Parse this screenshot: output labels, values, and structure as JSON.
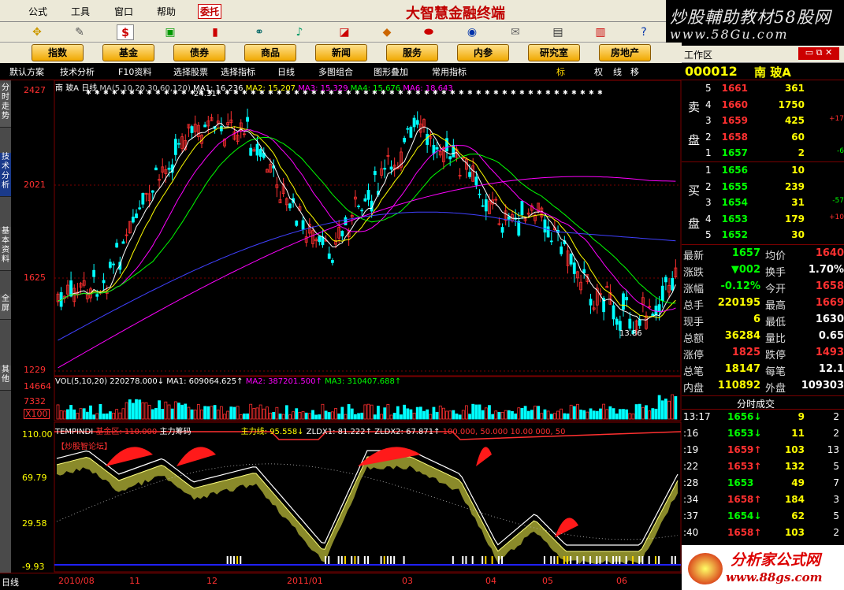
{
  "menu": {
    "items": [
      "公式",
      "工具",
      "窗口",
      "帮助"
    ],
    "hot": "委托",
    "app_title": "大智慧金融终端"
  },
  "watermark": {
    "line1": "炒股輔助教材58股网",
    "line2": "www.58Gu.com",
    "line3": "分析家公式网",
    "line4": "www.88gs.com"
  },
  "nav": [
    "指数",
    "基金",
    "债券",
    "商品",
    "新闻",
    "服务",
    "内参",
    "研究室",
    "房地产"
  ],
  "workarea": {
    "label": "工作区"
  },
  "toolbar2": {
    "items": [
      "默认方案",
      "技术分析",
      "F10资料",
      "选择股票",
      "选择指标",
      "日线",
      "多图组合",
      "图形叠加",
      "常用指标"
    ],
    "right": [
      "标",
      "权",
      "线",
      "移"
    ]
  },
  "sidetabs": [
    "分时走势",
    "技术分析",
    "基本资料",
    "全屏",
    "其他"
  ],
  "colors": {
    "up": "#ff3030",
    "down": "#00ffff",
    "ma1": "#ffffff",
    "ma2": "#ffff00",
    "ma3": "#ff00ff",
    "ma4": "#00ff00",
    "ma5": "#4040ff",
    "ma6": "#ff00ff",
    "grid": "#7a0000"
  },
  "price_panel": {
    "header": [
      "南",
      "玻A",
      "日线",
      "MA(5,10,20,30,60,120)",
      "MA1: 16.236",
      "MA2: 15.207",
      "MA3: 15.329",
      "MA4: 15.676",
      "MA6: 18.643"
    ],
    "yticks": [
      "2427",
      "2021",
      "1625",
      "1229"
    ],
    "hi_label": "24.31",
    "lo_label": "13.86"
  },
  "vol_panel": {
    "header": "VOL(5,10,20)",
    "values": [
      "220278.000↓",
      "MA1: 609064.625↑",
      "MA2: 387201.500↑",
      "MA3: 310407.688↑"
    ],
    "yticks": [
      "14664",
      "7332",
      "X100"
    ]
  },
  "ind_panel": {
    "header": "TEMPINDI",
    "items": [
      "基金区: 110.000",
      "主力筹码",
      "主力线: 95.558↓",
      "ZLDX1: 81.222↑",
      "ZLDX2: 67.871↑",
      "100.000, 50.000",
      "10.00 000, 50"
    ],
    "yticks": [
      "110.00",
      "69.79",
      "29.58",
      "-9.93"
    ],
    "forum": "【炒股智论坛】"
  },
  "xaxis": [
    "日线",
    "2010/08",
    "11",
    "12",
    "2011/01",
    "03",
    "04",
    "05",
    "06"
  ],
  "quote": {
    "code": "000012",
    "name": "南  玻A",
    "sell": [
      {
        "n": "5",
        "p": "1661",
        "v": "361",
        "c": ""
      },
      {
        "n": "4",
        "p": "1660",
        "v": "1750",
        "c": ""
      },
      {
        "n": "3",
        "p": "1659",
        "v": "425",
        "c": "+17"
      },
      {
        "n": "2",
        "p": "1658",
        "v": "60",
        "c": ""
      },
      {
        "n": "1",
        "p": "1657",
        "v": "2",
        "c": "-6"
      }
    ],
    "buy": [
      {
        "n": "1",
        "p": "1656",
        "v": "10",
        "c": ""
      },
      {
        "n": "2",
        "p": "1655",
        "v": "239",
        "c": ""
      },
      {
        "n": "3",
        "p": "1654",
        "v": "31",
        "c": "-57"
      },
      {
        "n": "4",
        "p": "1653",
        "v": "179",
        "c": "+10"
      },
      {
        "n": "5",
        "p": "1652",
        "v": "30",
        "c": ""
      }
    ],
    "sell_label": [
      "卖",
      "盘"
    ],
    "buy_label": [
      "买",
      "盘"
    ],
    "stats": [
      [
        "最新",
        "1657",
        "均价",
        "1640"
      ],
      [
        "涨跌",
        "▼002",
        "换手",
        "1.70%"
      ],
      [
        "涨幅",
        "-0.12%",
        "今开",
        "1658"
      ],
      [
        "总手",
        "220195",
        "最高",
        "1669"
      ],
      [
        "现手",
        "6",
        "最低",
        "1630"
      ],
      [
        "总额",
        "36284",
        "量比",
        "0.65"
      ],
      [
        "涨停",
        "1825",
        "跌停",
        "1493"
      ],
      [
        "总笔",
        "18147",
        "每笔",
        "12.1"
      ],
      [
        "内盘",
        "110892",
        "外盘",
        "109303"
      ]
    ]
  },
  "ticks": {
    "title": "分时成交",
    "rows": [
      [
        "13:17",
        "1656↓",
        "9",
        "2"
      ],
      [
        ":16",
        "1653↓",
        "11",
        "2"
      ],
      [
        ":19",
        "1659↑",
        "103",
        "13"
      ],
      [
        ":22",
        "1653↑",
        "132",
        "5"
      ],
      [
        ":28",
        "1653",
        "49",
        "7"
      ],
      [
        ":34",
        "1658↑",
        "184",
        "3"
      ],
      [
        ":37",
        "1654↓",
        "62",
        "5"
      ],
      [
        ":40",
        "1658↑",
        "103",
        "2"
      ]
    ]
  }
}
